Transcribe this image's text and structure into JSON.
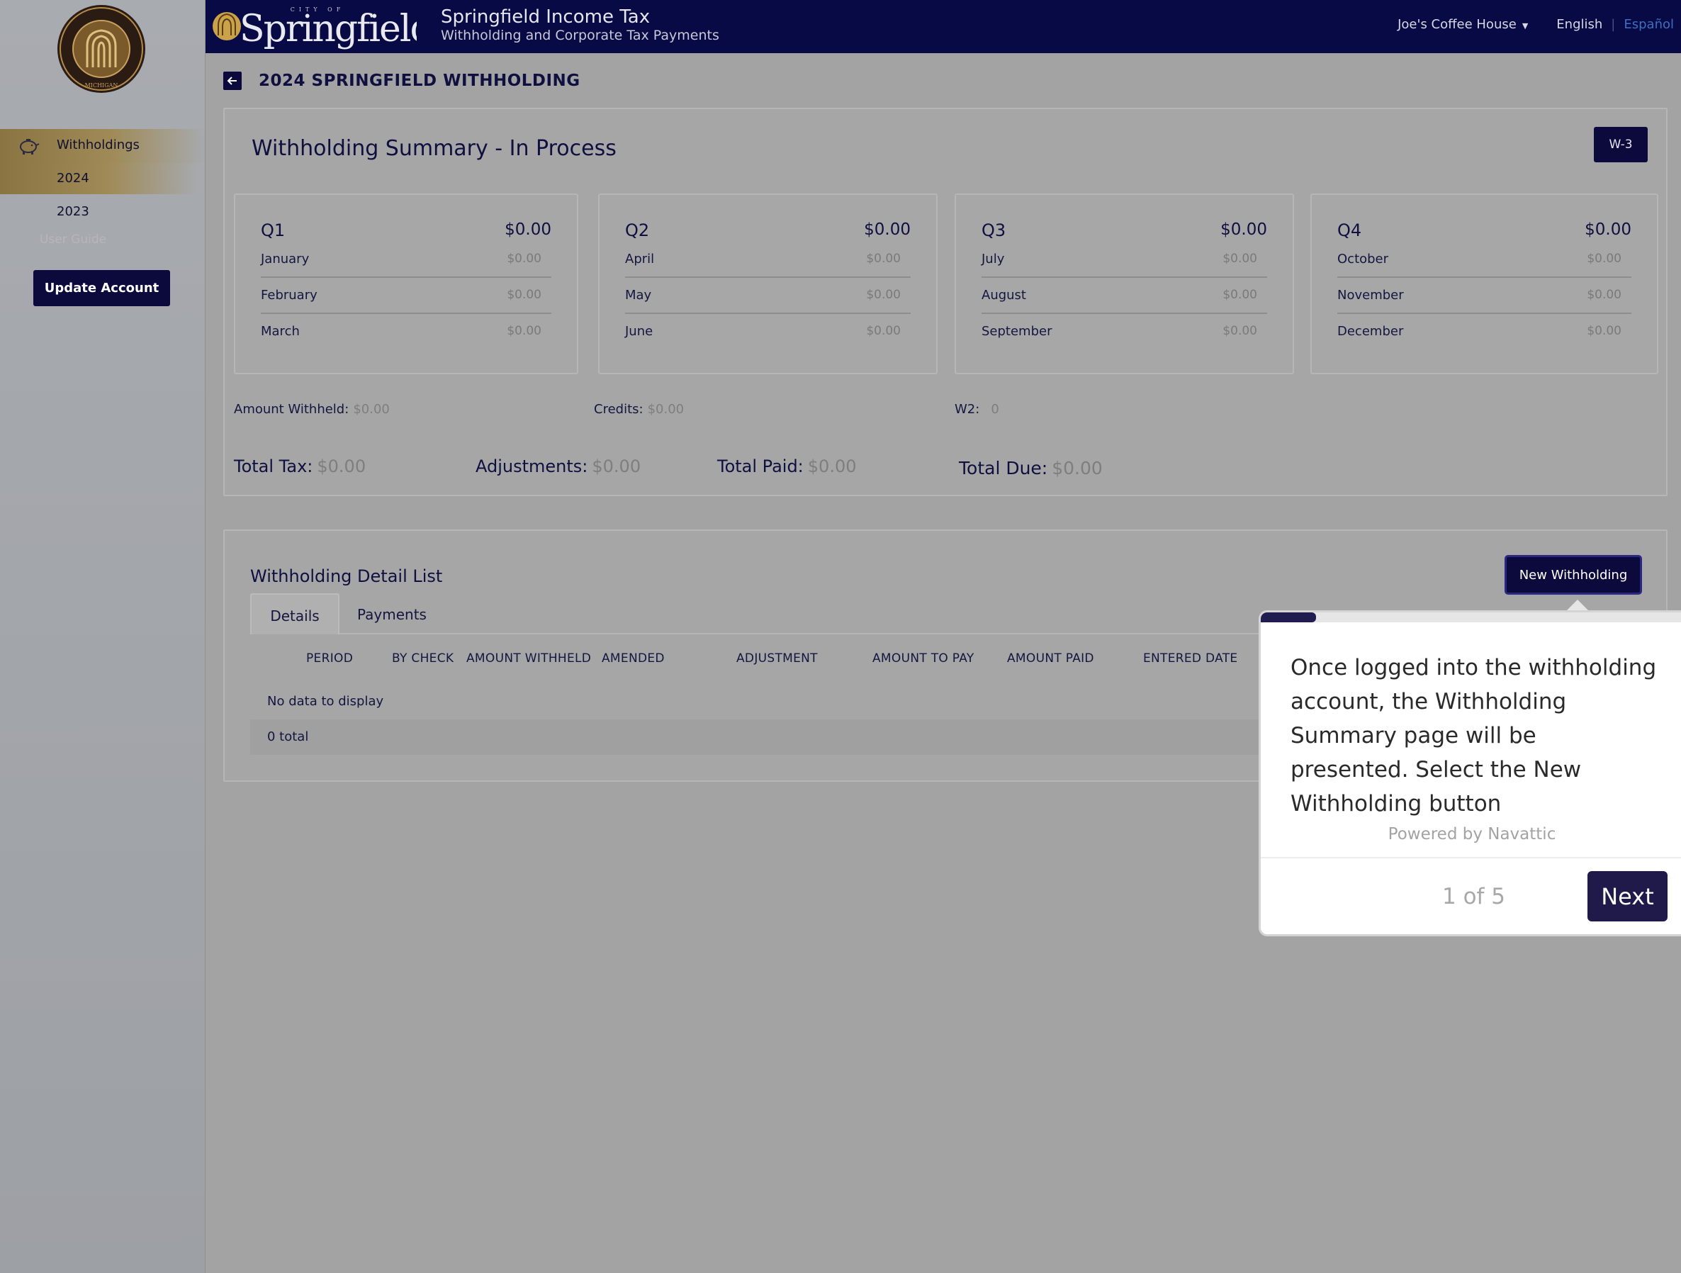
{
  "header": {
    "logo_text": "Springfield",
    "logo_small": "CITY OF",
    "title": "Springfield Income Tax",
    "subtitle": "Withholding and Corporate Tax Payments",
    "account": "Joe's Coffee House",
    "lang_english": "English",
    "lang_spanish": "Español"
  },
  "sidebar": {
    "seal_text": "CITY OF SPRINGFIELD",
    "seal_state": "MICHIGAN",
    "withholdings": "Withholdings",
    "year_2024": "2024",
    "year_2023": "2023",
    "user_guide": "User Guide",
    "update_account": "Update Account"
  },
  "page": {
    "title": "2024 SPRINGFIELD WITHHOLDING"
  },
  "summary": {
    "title": "Withholding Summary - In Process",
    "w3_label": "W-3",
    "quarters": [
      {
        "name": "Q1",
        "total": "$0.00",
        "months": [
          {
            "name": "January",
            "value": "$0.00"
          },
          {
            "name": "February",
            "value": "$0.00"
          },
          {
            "name": "March",
            "value": "$0.00"
          }
        ]
      },
      {
        "name": "Q2",
        "total": "$0.00",
        "months": [
          {
            "name": "April",
            "value": "$0.00"
          },
          {
            "name": "May",
            "value": "$0.00"
          },
          {
            "name": "June",
            "value": "$0.00"
          }
        ]
      },
      {
        "name": "Q3",
        "total": "$0.00",
        "months": [
          {
            "name": "July",
            "value": "$0.00"
          },
          {
            "name": "August",
            "value": "$0.00"
          },
          {
            "name": "September",
            "value": "$0.00"
          }
        ]
      },
      {
        "name": "Q4",
        "total": "$0.00",
        "months": [
          {
            "name": "October",
            "value": "$0.00"
          },
          {
            "name": "November",
            "value": "$0.00"
          },
          {
            "name": "December",
            "value": "$0.00"
          }
        ]
      }
    ],
    "amount_withheld_label": "Amount Withheld:",
    "amount_withheld_value": "$0.00",
    "credits_label": "Credits:",
    "credits_value": "$0.00",
    "w2_label": "W2:",
    "w2_value": "0",
    "total_tax_label": "Total Tax:",
    "total_tax_value": "$0.00",
    "adjustments_label": "Adjustments:",
    "adjustments_value": "$0.00",
    "total_paid_label": "Total Paid:",
    "total_paid_value": "$0.00",
    "total_due_label": "Total Due:",
    "total_due_value": "$0.00"
  },
  "detail": {
    "title": "Withholding Detail List",
    "new_button": "New Withholding",
    "tabs": [
      "Details",
      "Payments"
    ],
    "columns": [
      "PERIOD",
      "BY CHECK",
      "AMOUNT WITHHELD",
      "AMENDED",
      "ADJUSTMENT",
      "AMOUNT TO PAY",
      "AMOUNT PAID",
      "ENTERED DATE"
    ],
    "empty_text": "No data to display",
    "total_text": "0 total"
  },
  "tour": {
    "text": "Once logged into the withholding account, the Withholding Summary page will be presented. Select the New Withholding button",
    "powered_by": "Powered by Navattic",
    "step": "1 of 5",
    "progress": 0.2,
    "next_label": "Next"
  },
  "colors": {
    "navy": "#070a44",
    "button_navy": "#0c0a3c",
    "gold": "#a08b58",
    "tour_accent": "#1f1a49"
  }
}
